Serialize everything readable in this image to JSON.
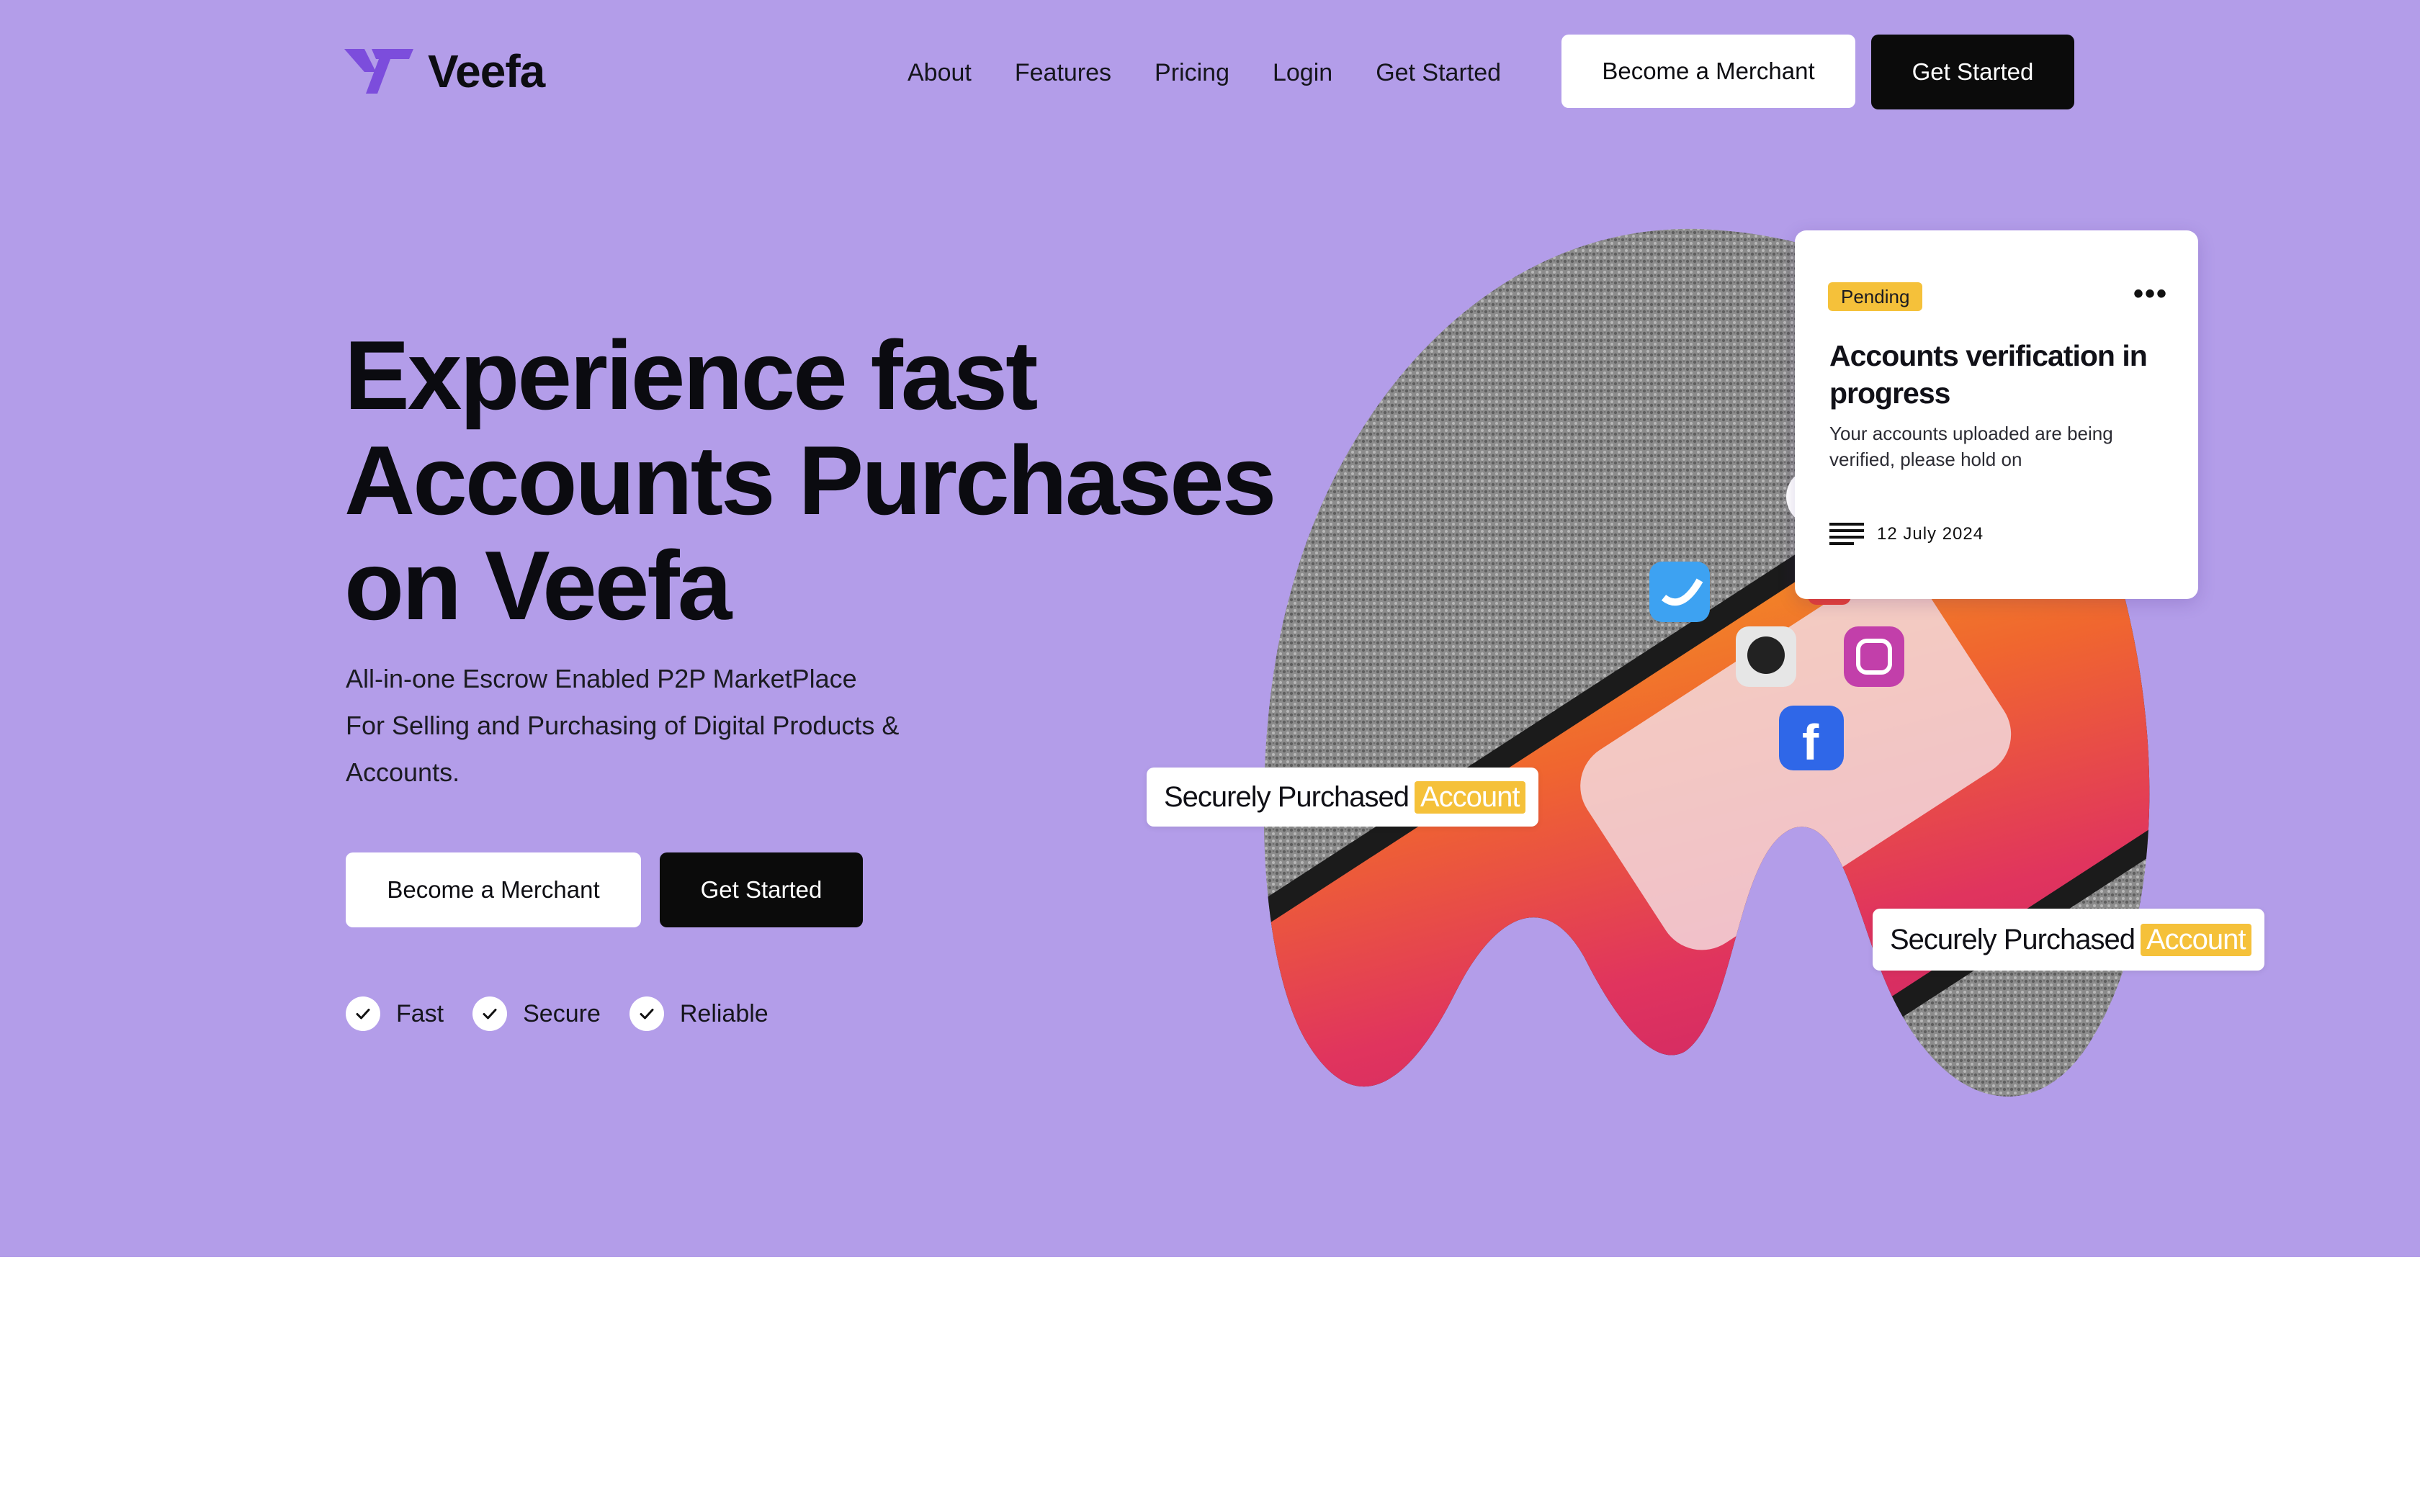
{
  "brand": {
    "name": "Veefa",
    "logo_icon": "veefa-v-logo",
    "accent": "#7c4ddc"
  },
  "colors": {
    "hero_bg": "#b39de9",
    "highlight": "#f5c13a",
    "black": "#0b0b0b",
    "white": "#ffffff"
  },
  "nav": {
    "links": [
      "About",
      "Features",
      "Pricing",
      "Login",
      "Get Started"
    ],
    "merchant_button": "Become a Merchant",
    "get_started_button": "Get Started"
  },
  "hero": {
    "headline": [
      "Experience fast",
      "Accounts Purchases",
      "on Veefa"
    ],
    "subtext": [
      "All-in-one Escrow Enabled P2P MarketPlace",
      "For Selling and Purchasing of Digital Products &",
      "Accounts."
    ],
    "merchant_button": "Become a Merchant",
    "get_started_button": "Get Started",
    "features": [
      "Fast",
      "Secure",
      "Reliable"
    ]
  },
  "status_card": {
    "badge": "Pending",
    "menu_icon": "more-horizontal-icon",
    "title": "Accounts verification in progress",
    "description": "Your accounts uploaded are being verified, please hold on",
    "date_icon": "lines-icon",
    "date": "12 July 2024"
  },
  "pills": [
    {
      "text": "Securely Purchased",
      "highlight": "Account"
    },
    {
      "text": "Securely Purchased",
      "highlight": "Account"
    }
  ]
}
